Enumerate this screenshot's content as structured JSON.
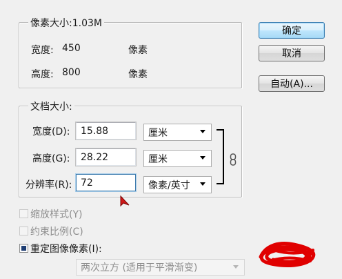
{
  "pixel_dimensions": {
    "legend": "像素大小:1.03M",
    "width_label": "宽度:",
    "width_value": "450",
    "width_unit": "像素",
    "height_label": "高度:",
    "height_value": "800",
    "height_unit": "像素"
  },
  "document_size": {
    "legend": "文档大小:",
    "width_label": "宽度(D):",
    "width_value": "15.88",
    "width_unit": "厘米",
    "height_label": "高度(G):",
    "height_value": "28.22",
    "height_unit": "厘米",
    "resolution_label": "分辨率(R):",
    "resolution_value": "72",
    "resolution_unit": "像素/英寸"
  },
  "options": {
    "scale_styles": "缩放样式(Y)",
    "constrain_proportions": "约束比例(C)",
    "resample_image": "重定图像像素(I):",
    "resample_method": "两次立方 (适用于平滑渐变)"
  },
  "buttons": {
    "ok": "确定",
    "cancel": "取消",
    "auto": "自动(A)..."
  },
  "colors": {
    "accent_default_button": "#3c7fb1",
    "scribble": "#e00000"
  }
}
